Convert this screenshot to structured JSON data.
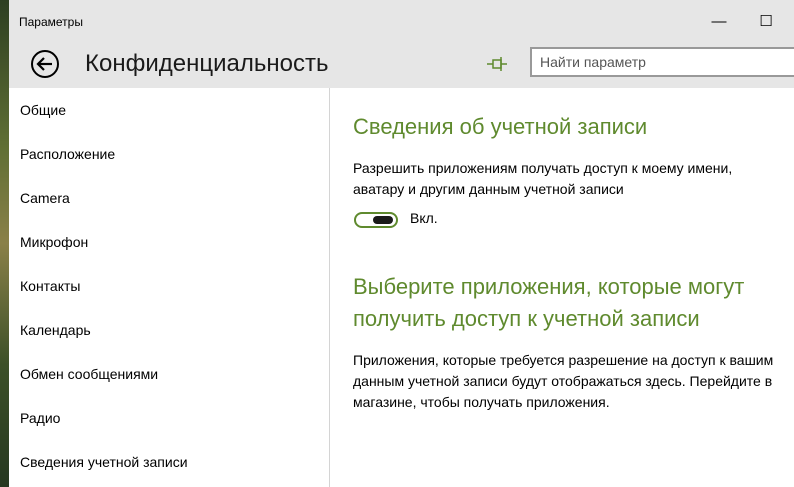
{
  "window": {
    "title": "Параметры",
    "minimize_glyph": "—",
    "maximize_glyph": "☐"
  },
  "header": {
    "back_icon": "back-arrow-icon",
    "title": "Конфиденциальность",
    "pin_icon": "pin-icon",
    "search_placeholder": "Найти параметр",
    "search_value": ""
  },
  "sidebar": {
    "items": [
      {
        "label": "Общие"
      },
      {
        "label": "Расположение"
      },
      {
        "label": "Camera"
      },
      {
        "label": "Микрофон"
      },
      {
        "label": "Контакты"
      },
      {
        "label": "Календарь"
      },
      {
        "label": "Обмен сообщениями"
      },
      {
        "label": "Радио"
      },
      {
        "label": "Сведения учетной записи"
      }
    ]
  },
  "content": {
    "section1": {
      "title": "Сведения об учетной записи",
      "description_lines": [
        "Разрешить приложениям получать доступ к моему имени,",
        "аватару и другим данным учетной записи"
      ],
      "toggle": {
        "state": "on",
        "label": "Вкл."
      }
    },
    "section2": {
      "title_lines": [
        "Выберите приложения, которые могут",
        "получить доступ к учетной записи"
      ],
      "description_lines": [
        "Приложения, которые требуется разрешение на доступ к вашим",
        "данным учетной записи будут отображаться здесь. Перейдите в",
        "магазине, чтобы получать приложения."
      ]
    }
  },
  "colors": {
    "accent": "#5f8a2e",
    "chrome": "#e6e6e6",
    "divider": "#d4d4d4"
  }
}
